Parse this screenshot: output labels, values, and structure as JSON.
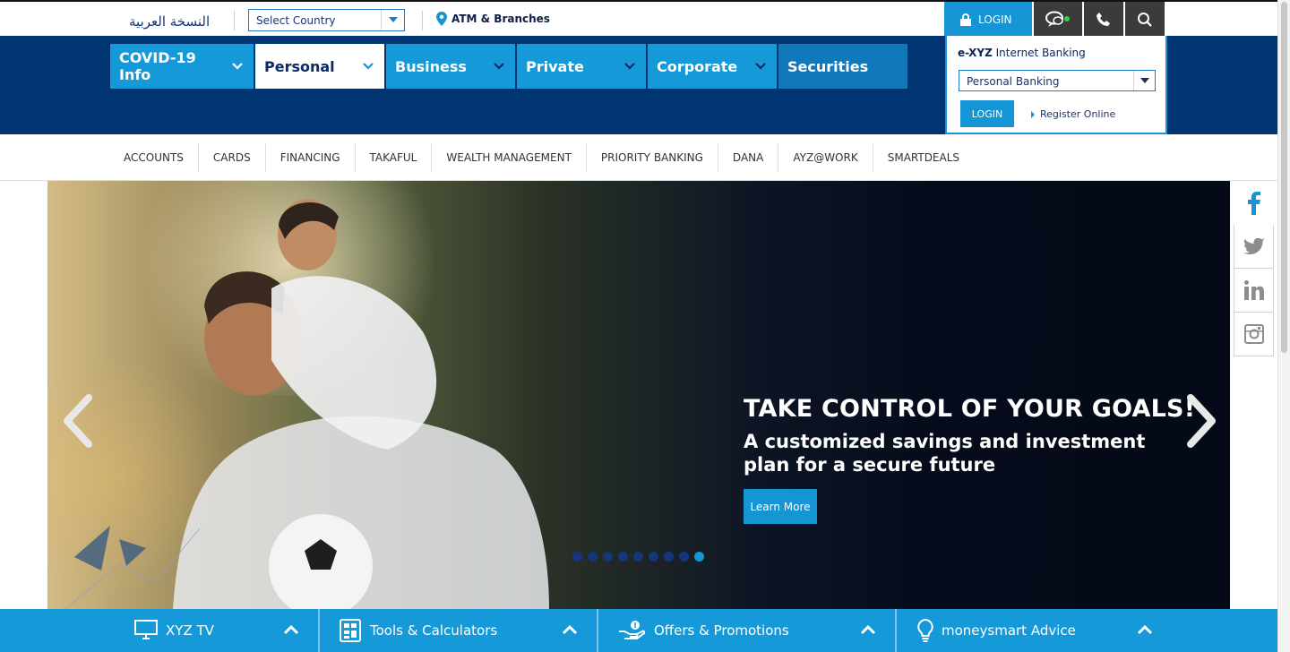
{
  "topbar": {
    "arabic_label": "النسخة العربية",
    "country_select": {
      "value": "Select Country"
    },
    "atm_label": "ATM & Branches",
    "login_label": "LOGIN"
  },
  "main_nav": [
    {
      "label": "COVID-19 Info",
      "has_dropdown": true
    },
    {
      "label": "Personal",
      "has_dropdown": true,
      "active": true
    },
    {
      "label": "Business",
      "has_dropdown": true
    },
    {
      "label": "Private",
      "has_dropdown": true
    },
    {
      "label": "Corporate",
      "has_dropdown": true
    },
    {
      "label": "Securities",
      "has_dropdown": false
    }
  ],
  "login_panel": {
    "title_bold": "e-XYZ",
    "title_rest": " Internet Banking",
    "select_value": "Personal Banking",
    "login_button": "LOGIN",
    "register_link": "Register Online"
  },
  "sub_nav": [
    "ACCOUNTS",
    "CARDS",
    "FINANCING",
    "TAKAFUL",
    "WEALTH MANAGEMENT",
    "PRIORITY BANKING",
    "DANA",
    "AYZ@WORK",
    "SMARTDEALS"
  ],
  "hero": {
    "headline": "TAKE CONTROL OF YOUR GOALS!",
    "subheadline": "A customized savings and investment plan for a secure future",
    "cta": "Learn More",
    "slide_count": 9,
    "active_slide": 9
  },
  "social": [
    "facebook-icon",
    "twitter-icon",
    "linkedin-icon",
    "instagram-icon"
  ],
  "bottom_bar": [
    {
      "label": "XYZ TV",
      "icon": "tv-icon"
    },
    {
      "label": "Tools & Calculators",
      "icon": "calculator-icon"
    },
    {
      "label": "Offers & Promotions",
      "icon": "offers-hand-icon"
    },
    {
      "label": "moneysmart Advice",
      "icon": "lightbulb-icon"
    }
  ],
  "colors": {
    "brand_blue": "#1599d8",
    "navy": "#003473",
    "dark_button": "#3b3b3b"
  }
}
